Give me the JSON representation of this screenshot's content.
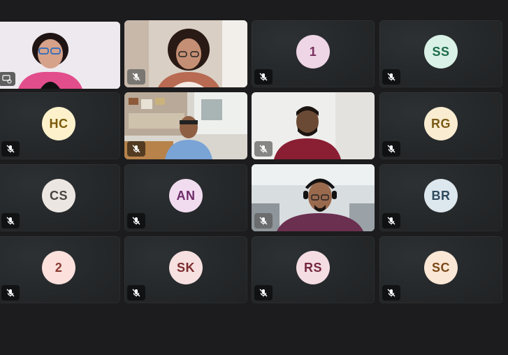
{
  "meeting": {
    "participants": [
      {
        "id": "p1",
        "type": "video",
        "muted": false,
        "active_speaker": true
      },
      {
        "id": "p2",
        "type": "video",
        "muted": true
      },
      {
        "id": "p3",
        "type": "avatar",
        "initials": "1",
        "avatar_bg": "#eed6e6",
        "avatar_fg": "#7a2e5d",
        "muted": true
      },
      {
        "id": "p4",
        "type": "avatar",
        "initials": "SS",
        "avatar_bg": "#d9f1e6",
        "avatar_fg": "#1e6a4c",
        "muted": true
      },
      {
        "id": "p5",
        "type": "avatar",
        "initials": "HC",
        "avatar_bg": "#fdf1cc",
        "avatar_fg": "#7a5a0a",
        "muted": true
      },
      {
        "id": "p6",
        "type": "video",
        "muted": true
      },
      {
        "id": "p7",
        "type": "video",
        "muted": true
      },
      {
        "id": "p8",
        "type": "avatar",
        "initials": "RG",
        "avatar_bg": "#f9ecd0",
        "avatar_fg": "#7a5a16",
        "muted": true
      },
      {
        "id": "p9",
        "type": "avatar",
        "initials": "CS",
        "avatar_bg": "#ece6e2",
        "avatar_fg": "#4a4440",
        "muted": true
      },
      {
        "id": "p10",
        "type": "avatar",
        "initials": "AN",
        "avatar_bg": "#f1dcef",
        "avatar_fg": "#6e2a6a",
        "muted": true
      },
      {
        "id": "p11",
        "type": "video",
        "muted": true
      },
      {
        "id": "p12",
        "type": "avatar",
        "initials": "BR",
        "avatar_bg": "#dde7ee",
        "avatar_fg": "#2f4a5e",
        "muted": true
      },
      {
        "id": "p13",
        "type": "avatar",
        "initials": "2",
        "avatar_bg": "#fbe0dc",
        "avatar_fg": "#8a3a30",
        "muted": true
      },
      {
        "id": "p14",
        "type": "avatar",
        "initials": "SK",
        "avatar_bg": "#f6e0e0",
        "avatar_fg": "#7a2c2c",
        "muted": true
      },
      {
        "id": "p15",
        "type": "avatar",
        "initials": "RS",
        "avatar_bg": "#f4dde3",
        "avatar_fg": "#73283d",
        "muted": true
      },
      {
        "id": "p16",
        "type": "avatar",
        "initials": "SC",
        "avatar_bg": "#fbe7d6",
        "avatar_fg": "#7a4a1a",
        "muted": true
      }
    ]
  }
}
